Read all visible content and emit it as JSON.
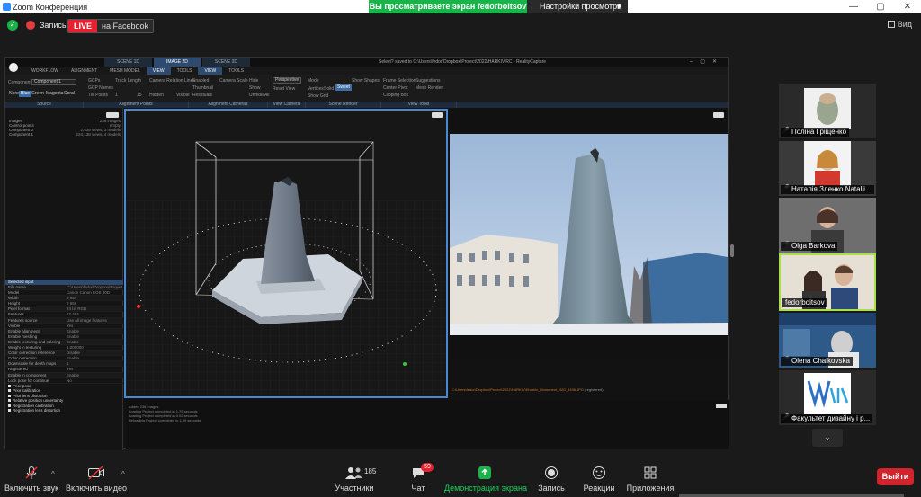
{
  "window": {
    "title": "Zoom Конференция",
    "controls": [
      "—",
      "▢",
      "✕"
    ]
  },
  "share": {
    "banner": "Вы просматриваете экран fedorboitsov",
    "view_settings": "Настройки просмотра"
  },
  "meeting_top": {
    "record_label": "Запись",
    "live_label": "LIVE",
    "live_target": "на Facebook",
    "view_label": "Вид"
  },
  "realitycapture": {
    "path": "Select? saved to C:\\Users\\fedor\\Dropbox\\Project\\2022\\HARKIV.RC - RealityCapture",
    "tabs": [
      "SCENE 1D",
      "IMAGE 2D",
      "SCENE 3D"
    ],
    "menu": [
      "WORKFLOW",
      "ALIGNMENT",
      "MESH MODEL",
      "VIEW",
      "TOOLS",
      "VIEW",
      "TOOLS"
    ],
    "ribbon": {
      "component_label": "Component",
      "component_value": "Component 1",
      "modes": [
        "None",
        "Blue",
        "Green",
        "Magenta",
        "Coral"
      ],
      "gcps_label": "GCPs",
      "gcp_names": "GCP Names",
      "tie_points": "Tie Points",
      "track_length": "Track Length",
      "camera_relation": "Camera Relation Lines",
      "hidden": "Hidden",
      "visible": "Visible",
      "enabled": "Enabled",
      "thumbnail": "Thumbnail",
      "residuals": "Residuals",
      "camera_scale": "Camera Scale",
      "hide": "Hide",
      "show": "Show",
      "unhide_all": "Unhide All",
      "projection": "Perspective",
      "reset_view": "Reset View",
      "mode": "Mode",
      "vertices": "Vertices",
      "solid": "Solid",
      "sweet": "Sweet",
      "show_grid": "Show Grid",
      "show_shapes": "Show Shapes",
      "frame_selection": "Frame Selection",
      "center_pivot": "Center Pivot",
      "clipping_box": "Clipping Box",
      "suggestions": "Suggestions",
      "mesh_render": "Mesh Render",
      "track_min": "1",
      "track_max": "15"
    },
    "groups": [
      "Source",
      "Alignment Points",
      "Alignment Cameras",
      "View Camera",
      "Scene Render",
      "View Tools"
    ],
    "tree": [
      {
        "label": "Images",
        "value": "236 images"
      },
      {
        "label": "Control points",
        "value": "empty"
      },
      {
        "label": "Component 0",
        "value": "2,539 views, 3 models"
      },
      {
        "label": "Component 1",
        "value": "224,138 views, 4 models"
      }
    ],
    "props_header": "Selected input",
    "props": [
      {
        "k": "File name",
        "v": "C:\\Users\\fedor\\Dropbox\\Project..."
      },
      {
        "k": "Model",
        "v": "Canon Canon EOS 80D"
      },
      {
        "k": "Width",
        "v": "3 984"
      },
      {
        "k": "Height",
        "v": "2 656"
      },
      {
        "k": "Pixel format",
        "v": "24 bit RGB"
      },
      {
        "k": "Features",
        "v": "17 484"
      },
      {
        "k": "Features source",
        "v": "Use all image features"
      },
      {
        "k": "Visible",
        "v": "Yes"
      },
      {
        "k": "Enable alignment",
        "v": "Enable"
      },
      {
        "k": "Enable meshing",
        "v": "Enable"
      },
      {
        "k": "Enable texturing and coloring",
        "v": "Enable"
      },
      {
        "k": "Weight in texturing",
        "v": "1.000000"
      },
      {
        "k": "Color correction reference",
        "v": "Disable"
      },
      {
        "k": "Color correction",
        "v": "Enable"
      },
      {
        "k": "Downscale for depth maps",
        "v": "1"
      },
      {
        "k": "Registered",
        "v": "Yes"
      },
      {
        "k": "Enable in component",
        "v": "Enable"
      },
      {
        "k": "Lock pose for continue",
        "v": "No"
      }
    ],
    "prior_checks": [
      "Prior pose",
      "Prior calibration",
      "Prior lens distortion",
      "Relative position uncertainty",
      "Registration calibration",
      "Registration lens distortion"
    ],
    "image_caption": "C:\\Users\\fedor\\Dropbox\\Project\\2022\\HARKIV\\Kharkiv_Monument_IMG_3496.JPG",
    "image_caption_status": "(registered)",
    "console": [
      "Added 236 images",
      "Loading Project completed in 1.79 seconds",
      "Loading Project completed in 0.02 seconds",
      "Reloading Project completed in 1.09 seconds"
    ]
  },
  "participants": [
    {
      "name": "Поліна Гріщенко",
      "muted": true
    },
    {
      "name": "Наталія Зленко Natalii...",
      "muted": true
    },
    {
      "name": "Olga Barkova",
      "muted": true
    },
    {
      "name": "fedorboitsov",
      "muted": false,
      "active": true
    },
    {
      "name": "Olena Chaikovska",
      "muted": true
    },
    {
      "name": "Факультет дизайну і р...",
      "muted": true
    }
  ],
  "toolbar": {
    "mic_label": "Включить звук",
    "video_label": "Включить видео",
    "participants_label": "Участники",
    "participants_count": "185",
    "chat_label": "Чат",
    "chat_badge": "59",
    "share_label": "Демонстрация экрана",
    "record_label": "Запись",
    "reactions_label": "Реакции",
    "apps_label": "Приложения",
    "exit_label": "Выйти"
  },
  "colors": {
    "share_green": "#19b34a",
    "live_red": "#e8202f",
    "active_speaker": "#a8e04c",
    "viewport_selected": "#4a88d4"
  }
}
